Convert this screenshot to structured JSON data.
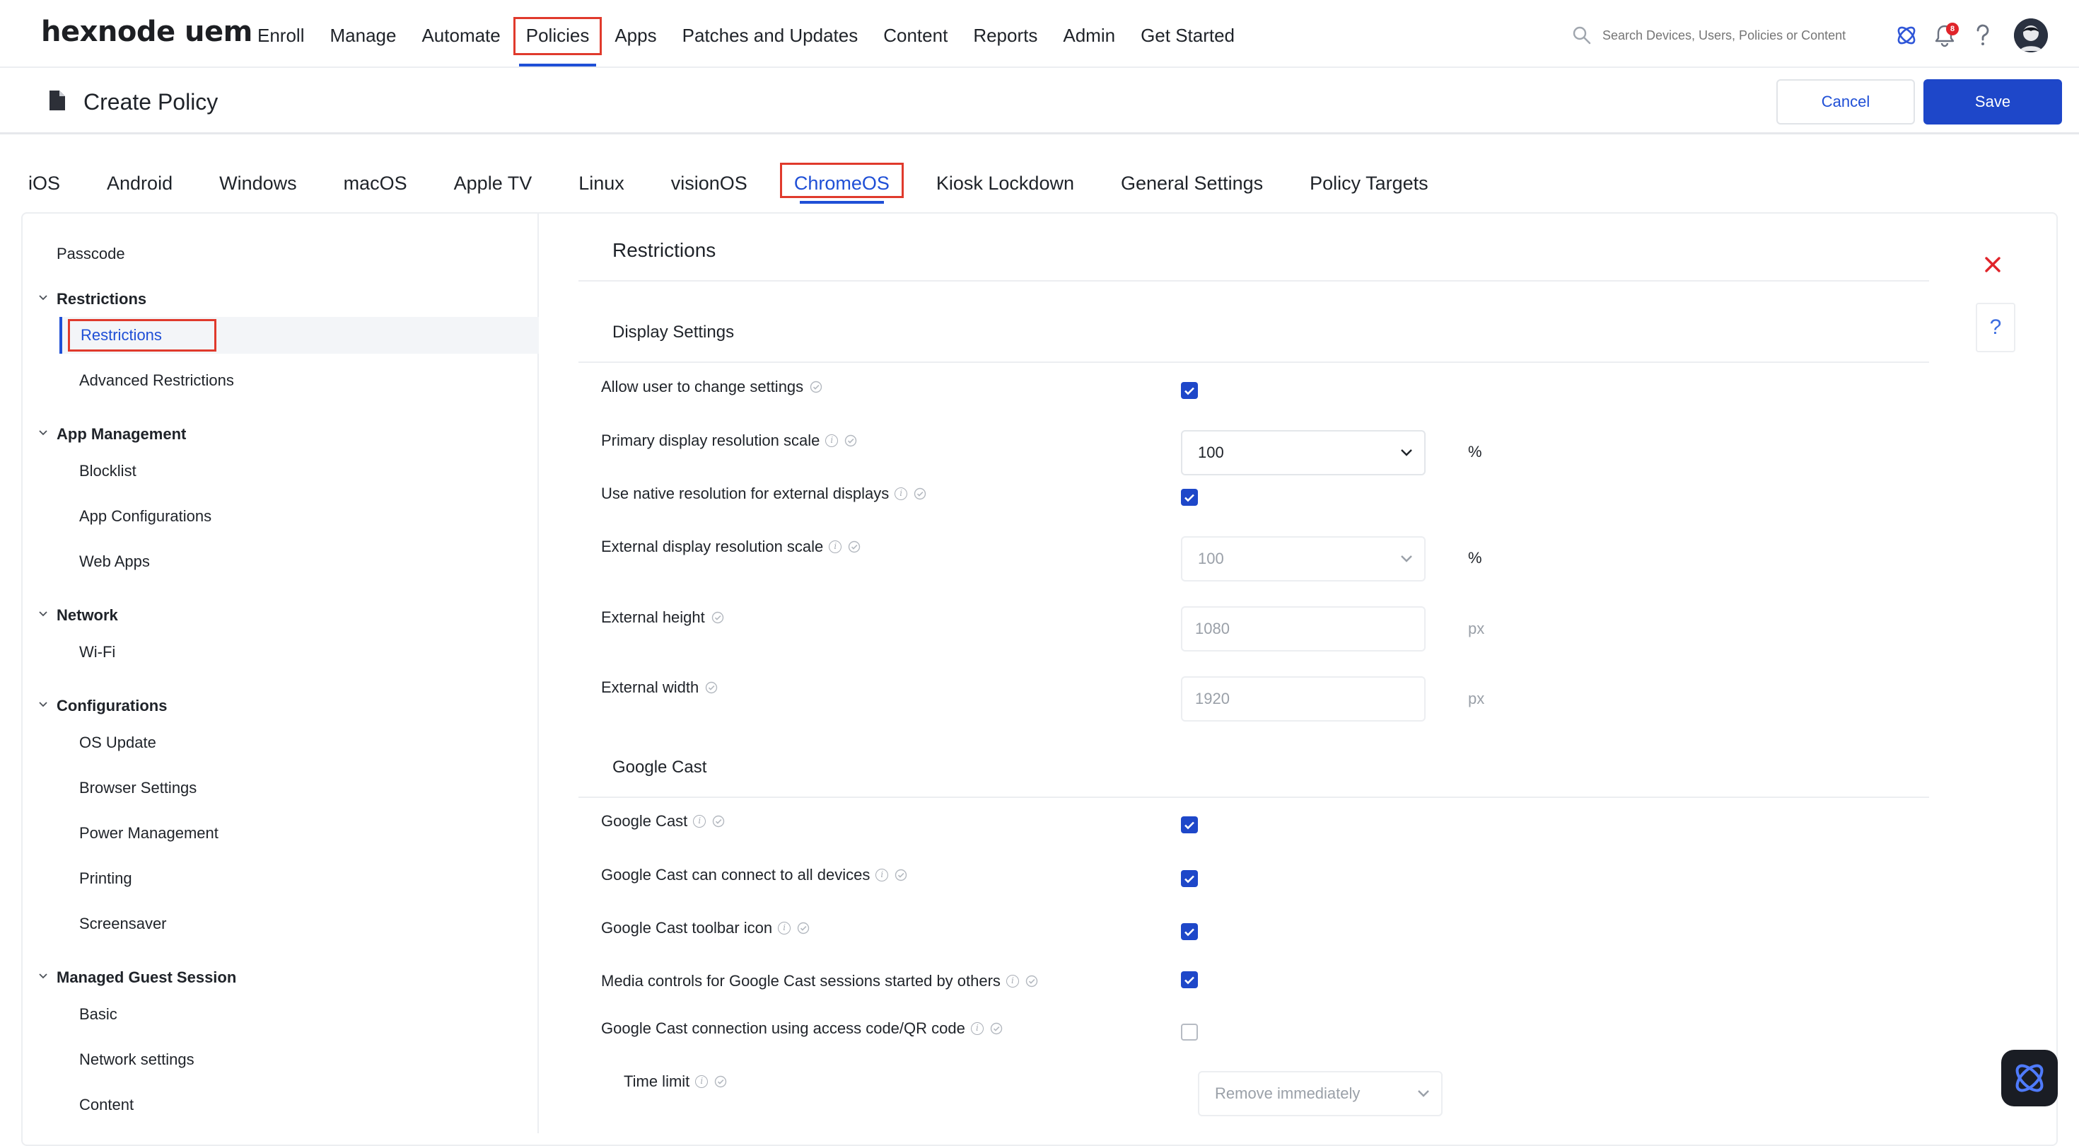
{
  "app": {
    "logo": "hexnode uem"
  },
  "nav": {
    "items": [
      "Enroll",
      "Manage",
      "Automate",
      "Policies",
      "Apps",
      "Patches and Updates",
      "Content",
      "Reports",
      "Admin",
      "Get Started"
    ],
    "active": "Policies"
  },
  "search": {
    "placeholder": "Search Devices, Users, Policies or Content"
  },
  "notifications": {
    "count": "8"
  },
  "header": {
    "title": "Create Policy",
    "cancel_label": "Cancel",
    "save_label": "Save"
  },
  "platform_tabs": {
    "items": [
      "iOS",
      "Android",
      "Windows",
      "macOS",
      "Apple TV",
      "Linux",
      "visionOS",
      "ChromeOS",
      "Kiosk Lockdown",
      "General Settings",
      "Policy Targets"
    ],
    "active": "ChromeOS"
  },
  "sidebar": {
    "passcode": "Passcode",
    "groups": {
      "restrictions": {
        "label": "Restrictions",
        "items": [
          "Restrictions",
          "Advanced Restrictions"
        ]
      },
      "app_management": {
        "label": "App Management",
        "items": [
          "Blocklist",
          "App Configurations",
          "Web Apps"
        ]
      },
      "network": {
        "label": "Network",
        "items": [
          "Wi-Fi"
        ]
      },
      "configurations": {
        "label": "Configurations",
        "items": [
          "OS Update",
          "Browser Settings",
          "Power Management",
          "Printing",
          "Screensaver"
        ]
      },
      "managed_guest_session": {
        "label": "Managed Guest Session",
        "items": [
          "Basic",
          "Network settings",
          "Content"
        ]
      }
    },
    "selected": "Restrictions"
  },
  "content": {
    "title": "Restrictions",
    "help": "?",
    "display_settings": {
      "heading": "Display Settings",
      "allow_change": {
        "label": "Allow user to change settings",
        "checked": true
      },
      "primary_scale": {
        "label": "Primary display resolution scale",
        "value": "100",
        "unit": "%"
      },
      "native_external": {
        "label": "Use native resolution for external displays",
        "checked": true
      },
      "external_scale": {
        "label": "External display resolution scale",
        "value": "100",
        "unit": "%"
      },
      "external_height": {
        "label": "External height",
        "value": "1080",
        "unit": "px"
      },
      "external_width": {
        "label": "External width",
        "value": "1920",
        "unit": "px"
      }
    },
    "google_cast": {
      "heading": "Google Cast",
      "cast": {
        "label": "Google Cast",
        "checked": true
      },
      "connect_all": {
        "label": "Google Cast can connect to all devices",
        "checked": true
      },
      "toolbar_icon": {
        "label": "Google Cast toolbar icon",
        "checked": true
      },
      "media_controls": {
        "label": "Media controls for Google Cast sessions started by others",
        "checked": true
      },
      "access_code": {
        "label": "Google Cast connection using access code/QR code",
        "checked": false
      },
      "time_limit": {
        "label": "Time limit",
        "value": "Remove immediately"
      }
    }
  },
  "colors": {
    "accent": "#1e47c9",
    "highlight": "#e03a2c"
  }
}
